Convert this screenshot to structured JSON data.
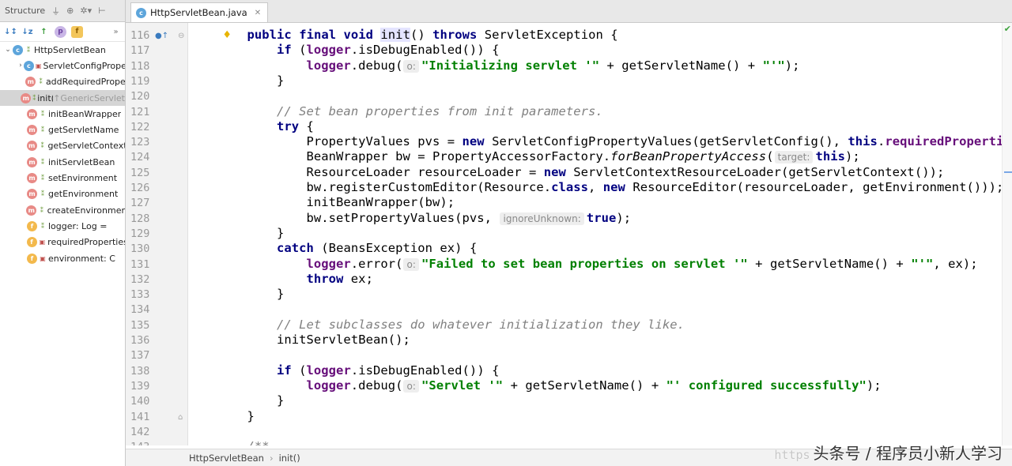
{
  "structure_panel": {
    "title": "Structure",
    "items": [
      {
        "icon": "class-icon",
        "vis": "",
        "label": "HttpServletBean",
        "suffix": "",
        "expand": "v",
        "indent": 0
      },
      {
        "icon": "class-icon",
        "vis": "lock",
        "label": "ServletConfigPropertyValues",
        "suffix": "",
        "expand": ">",
        "indent": 1
      },
      {
        "icon": "method-icon",
        "vis": "",
        "label": "addRequiredProperty",
        "suffix": "",
        "expand": "",
        "indent": 1
      },
      {
        "icon": "method-icon",
        "vis": "",
        "label": "init(): void",
        "suffix": "↑GenericServlet",
        "expand": "",
        "indent": 1,
        "selected": true
      },
      {
        "icon": "method-icon",
        "vis": "",
        "label": "initBeanWrapper",
        "suffix": "",
        "expand": "",
        "indent": 1
      },
      {
        "icon": "method-icon",
        "vis": "",
        "label": "getServletName",
        "suffix": "",
        "expand": "",
        "indent": 1
      },
      {
        "icon": "method-icon",
        "vis": "",
        "label": "getServletContext",
        "suffix": "",
        "expand": "",
        "indent": 1
      },
      {
        "icon": "method-icon",
        "vis": "",
        "label": "initServletBean",
        "suffix": "",
        "expand": "",
        "indent": 1
      },
      {
        "icon": "method-icon",
        "vis": "",
        "label": "setEnvironment",
        "suffix": "",
        "expand": "",
        "indent": 1
      },
      {
        "icon": "method-icon",
        "vis": "",
        "label": "getEnvironment",
        "suffix": "",
        "expand": "",
        "indent": 1
      },
      {
        "icon": "method-icon",
        "vis": "",
        "label": "createEnvironment",
        "suffix": "",
        "expand": "",
        "indent": 1
      },
      {
        "icon": "field-icon",
        "vis": "",
        "label": "logger: Log = ",
        "suffix": "",
        "expand": "",
        "indent": 1
      },
      {
        "icon": "field-icon",
        "vis": "lock",
        "label": "requiredProperties",
        "suffix": "",
        "expand": "",
        "indent": 1
      },
      {
        "icon": "field-icon",
        "vis": "lock",
        "label": "environment: C",
        "suffix": "",
        "expand": "",
        "indent": 1
      }
    ]
  },
  "editor": {
    "tab": {
      "label": "HttpServletBean.java"
    },
    "line_numbers": [
      "116",
      "117",
      "118",
      "119",
      "120",
      "121",
      "122",
      "123",
      "124",
      "125",
      "126",
      "127",
      "128",
      "129",
      "130",
      "131",
      "132",
      "133",
      "134",
      "135",
      "136",
      "137",
      "138",
      "139",
      "140",
      "141",
      "142",
      "143"
    ],
    "code": {
      "l116": [
        "public",
        "final",
        "void",
        "init",
        "() ",
        "throws",
        " ServletException {"
      ],
      "l117": [
        "if",
        " (",
        "logger",
        ".isDebugEnabled()) {"
      ],
      "l118": [
        "logger",
        ".debug(",
        "o:",
        "\"Initializing servlet '\"",
        " + getServletName() + ",
        "\"'\"",
        ");"
      ],
      "l119": "}",
      "l121": "// Set bean properties from init parameters.",
      "l122": [
        "try",
        " {"
      ],
      "l123": [
        "PropertyValues pvs = ",
        "new",
        " ServletConfigPropertyValues(getServletConfig(), ",
        "this",
        ".",
        "requiredProperties"
      ],
      "l124": [
        "BeanWrapper bw = PropertyAccessorFactory.",
        "forBeanPropertyAccess",
        "(",
        "target:",
        "this",
        ");"
      ],
      "l125": [
        "ResourceLoader resourceLoader = ",
        "new",
        " ServletContextResourceLoader(getServletContext());"
      ],
      "l126": [
        "bw.registerCustomEditor(Resource.",
        "class",
        ", ",
        "new",
        " ResourceEditor(resourceLoader, getEnvironment()));"
      ],
      "l127": "initBeanWrapper(bw);",
      "l128": [
        "bw.setPropertyValues(pvs, ",
        "ignoreUnknown:",
        "true",
        ");"
      ],
      "l129": "}",
      "l130": [
        "catch",
        " (BeansException ex) {"
      ],
      "l131": [
        "logger",
        ".error(",
        "o:",
        "\"Failed to set bean properties on servlet '\"",
        " + getServletName() + ",
        "\"'\"",
        ", ex);"
      ],
      "l132": [
        "throw",
        " ex;"
      ],
      "l133": "}",
      "l135": "// Let subclasses do whatever initialization they like.",
      "l136": "initServletBean();",
      "l138": [
        "if",
        " (",
        "logger",
        ".isDebugEnabled()) {"
      ],
      "l139": [
        "logger",
        ".debug(",
        "o:",
        "\"Servlet '\"",
        " + getServletName() + ",
        "\"' configured successfully\"",
        ");"
      ],
      "l140": "}",
      "l141": "}",
      "l143": "/**"
    }
  },
  "breadcrumb": [
    "HttpServletBean",
    "init()"
  ],
  "watermark": {
    "url": "https",
    "text": "头条号 / 程序员小新人学习"
  },
  "colors": {
    "keyword": "#000080",
    "string": "#008000",
    "comment": "#808080",
    "field": "#660e7a",
    "gutter": "#f2f2f2"
  }
}
